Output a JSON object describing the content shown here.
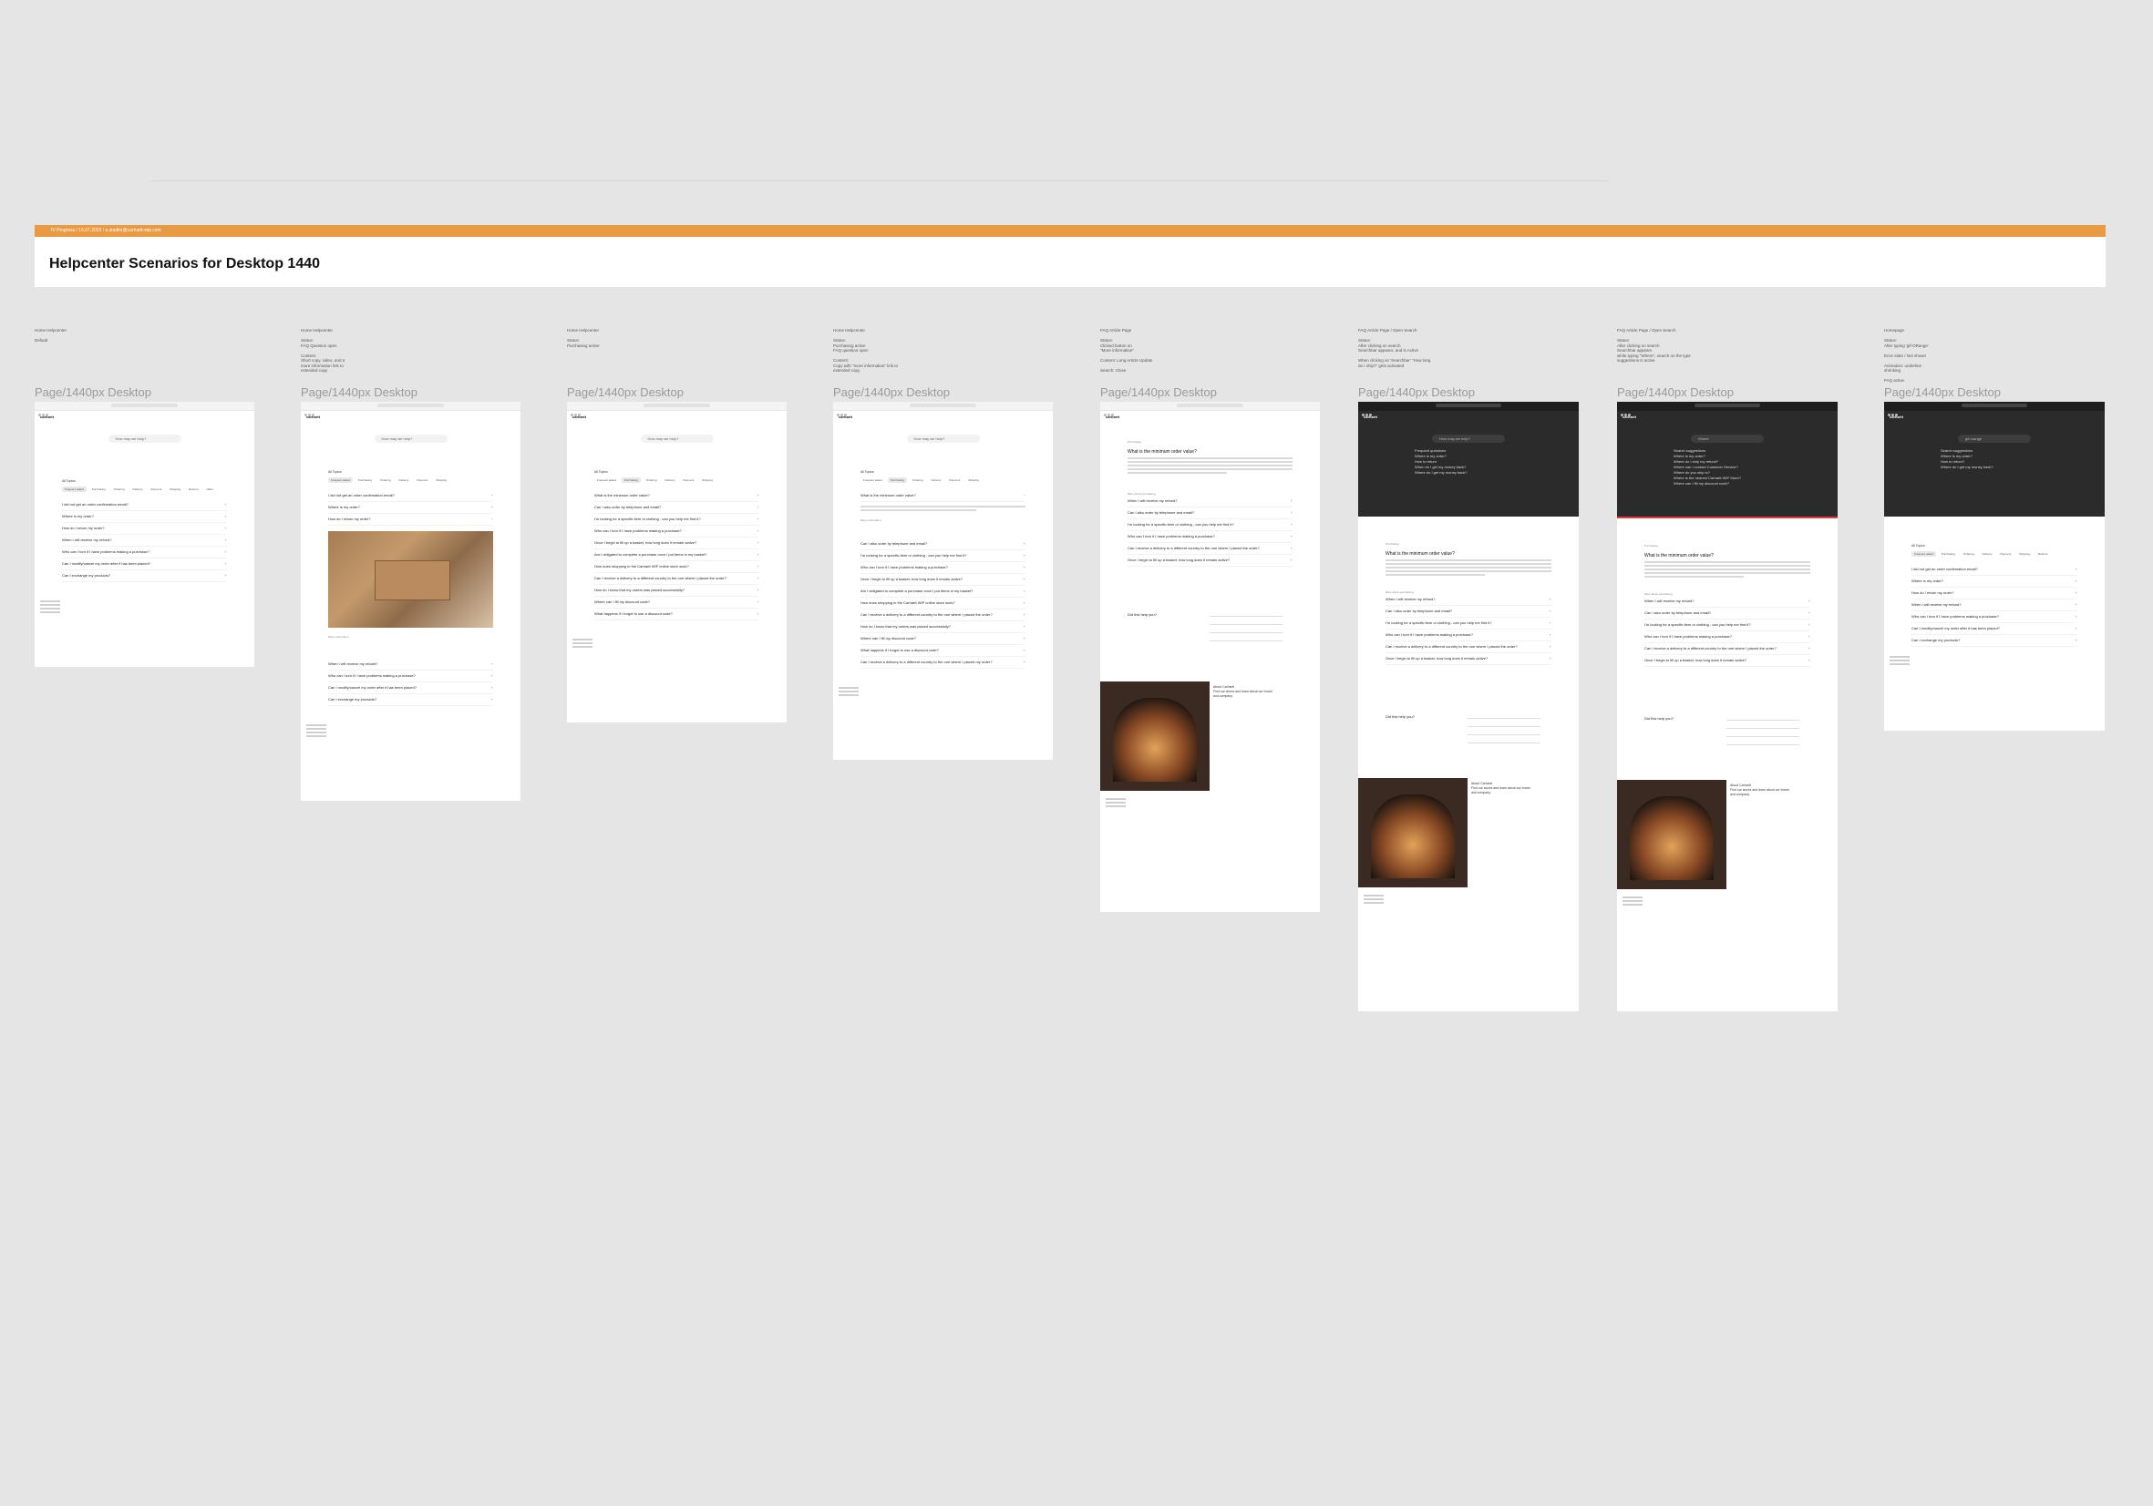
{
  "banner": {
    "meta": "IV Progress  /  15.07.2023  /  a.stadler@carhartt-wip.com",
    "title": "Helpcenter Scenarios for Desktop 1440",
    "accent": "#e89a45"
  },
  "frame_label": "Page/1440px Desktop",
  "frames": [
    {
      "note": "Home Helpcenter\n\nDefault"
    },
    {
      "note": "Home Helpcenter\n\nStatus:\nFAQ Question open\n\nContent:\nShort copy, video, and a\nmore information link to\nextended copy"
    },
    {
      "note": "Home Helpcenter\n\nStatus:\nPurchasing active"
    },
    {
      "note": "Home Helpcenter\n\nStatus:\nPurchasing active\nFAQ question open\n\nContent:\nCopy with \"more information\" link to\nextended copy"
    },
    {
      "note": "FAQ Article Page\n\nStatus:\nClicked button on\n\"More information\"\n\nContent: Long Article Update\n\nSearch: Close"
    },
    {
      "note": "FAQ Article Page / Open Search\n\nStatus:\nAfter clicking on search\nSearchbar appears, and is Active\n\nWhen clicking on 'Searchbar' \"How long\ndo I ship?\" gets activated"
    },
    {
      "note": "FAQ Article Page / Open Search\n\nStatus:\nAfter clicking on search\nSearchbar appears\nwhile typing \"Where\", search on the type\nsuggestions is active"
    },
    {
      "note": "Homepage\n\nStatus:\nAfter typing 'gif-ORange'\n\nError state / Not shown\n\nAnimation: underline\nshrinking\n\nFAQ active"
    }
  ],
  "ui": {
    "logo": "carhartt",
    "search_placeholder": "How may we help?",
    "topics_label": "All Topics",
    "chips": [
      "Frequent asked",
      "Purchasing",
      "Ordering",
      "Delivery",
      "Payment",
      "Shipping",
      "Returns",
      "Other"
    ],
    "questions_home": [
      "I did not get an order confirmation email?",
      "Where is my order?",
      "How do I return my order?",
      "When I will receive my refund?",
      "Who can I turn if I have problems making a purchase?",
      "Can I modify/cancel my order after it has been placed?",
      "Can I exchange my products?"
    ],
    "questions_purchasing": [
      "What is the minimum order value?",
      "Can I also order by telephone and email?",
      "I'm looking for a specific item or clothing - can you help me find it?",
      "Who can I turn if I have problems making a purchase?",
      "Once I begin to fill up a basket, how long does it remain active?",
      "Am I obligated to complete a purchase once I put items in my basket?",
      "How does shopping in the Carhartt WIP online store work?",
      "Can I receive a delivery to a different country to the one where I placed the order?",
      "How do I know that my orders was placed successfully?",
      "Where can I fill my discount code?",
      "What happens if I forgot to use a discount code?",
      "Can I receive a delivery to a different country to the one where I placed my order?"
    ],
    "article_title": "What is the minimum order value?",
    "more_info": "More information",
    "related_label": "More about purchasing",
    "form_label": "Did this help you?",
    "store_label": "About Carhartt",
    "store_text": "Find our stores and learn about our brand and company.",
    "suggestions_a": [
      "Frequent questions",
      "Where is my order?",
      "How to return",
      "When do I get my money back?",
      "Where do I get my money back?"
    ],
    "suggestions_b": [
      "Search suggestions",
      "Where is my order?",
      "Where do I ship my refund?",
      "Where can I contact Customer Service?",
      "Where do you ship to?",
      "Where is the nearest Carhartt WIP Store?",
      "Where can I fill my discount code?"
    ],
    "suggestions_c": [
      "Search suggestions",
      "Where is my order?",
      "How to return?",
      "Where do I get my money back?"
    ],
    "search_b": "Where",
    "search_c": "gif-orange"
  }
}
